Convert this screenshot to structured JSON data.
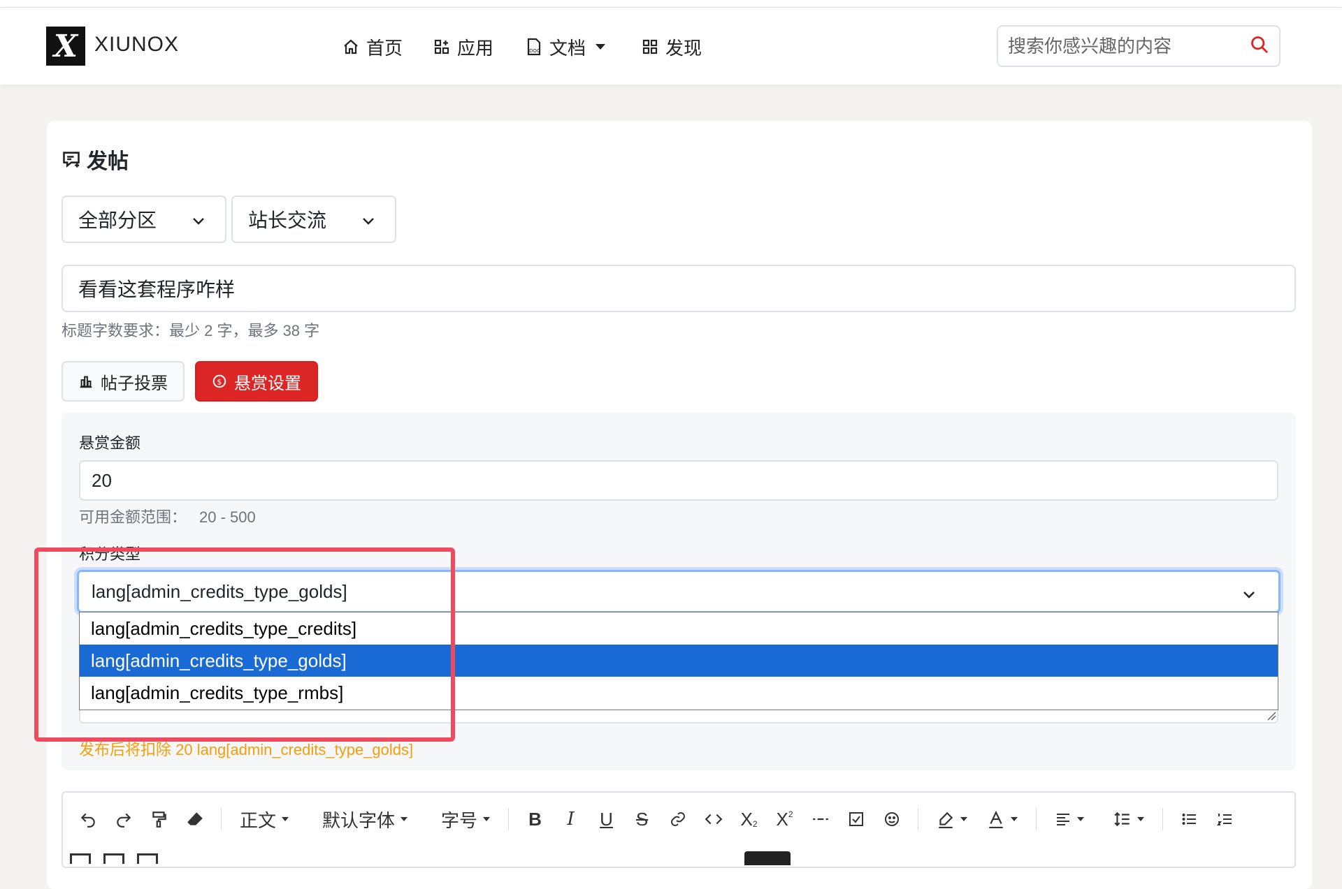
{
  "header": {
    "brand": "XIUNOX",
    "logo_letter": "X",
    "nav": [
      {
        "label": "首页",
        "icon": "home-icon"
      },
      {
        "label": "应用",
        "icon": "apps-icon"
      },
      {
        "label": "文档",
        "icon": "doc-icon",
        "has_dropdown": true
      },
      {
        "label": "发现",
        "icon": "grid-icon"
      }
    ],
    "search_placeholder": "搜索你感兴趣的内容"
  },
  "page": {
    "title": "发帖",
    "forum_select": "全部分区",
    "board_select": "站长交流",
    "post_title_value": "看看这套程序咋样",
    "title_hint": "标题字数要求：最少 2 字，最多 38 字",
    "vote_button": "帖子投票",
    "reward_button": "悬赏设置"
  },
  "reward": {
    "amount_label": "悬赏金额",
    "amount_value": "20",
    "range_label": "可用金额范围：",
    "range_value": "20 - 500",
    "credit_type_label": "积分类型",
    "credit_type_selected": "lang[admin_credits_type_golds]",
    "options": [
      "lang[admin_credits_type_credits]",
      "lang[admin_credits_type_golds]",
      "lang[admin_credits_type_rmbs]"
    ],
    "selected_index": 1,
    "deduct_notice": "发布后将扣除 20 lang[admin_credits_type_golds]"
  },
  "editor": {
    "paragraph": "正文",
    "font_family": "默认字体",
    "font_size": "字号"
  },
  "colors": {
    "accent_red": "#dc2626",
    "highlight_box": "#ef4a5e",
    "selected_option": "#1a6ad6",
    "warning": "#f59e0b"
  }
}
